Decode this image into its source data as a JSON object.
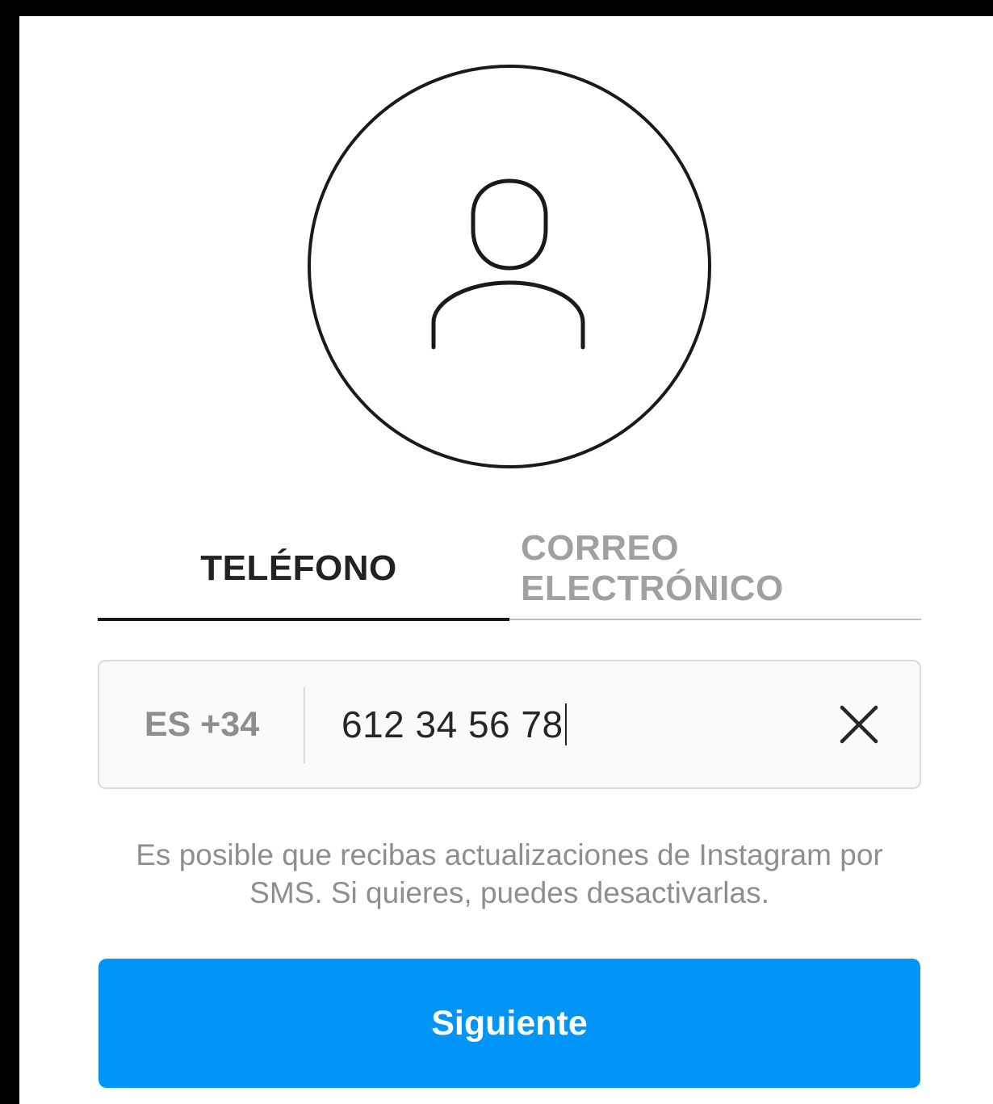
{
  "avatar": {
    "icon": "user-silhouette-icon"
  },
  "tabs": [
    {
      "label": "TELÉFONO",
      "active": true
    },
    {
      "label": "CORREO ELECTRÓNICO",
      "active": false
    }
  ],
  "phone": {
    "country_code": "ES +34",
    "value": "612 34 56 78",
    "clear_icon": "close-icon"
  },
  "notice": {
    "line1": "Es posible que recibas actualizaciones de Instagram por",
    "line2": "SMS. Si quieres, puedes desactivarlas."
  },
  "actions": {
    "next_label": "Siguiente"
  },
  "colors": {
    "primary_button": "#0095f6",
    "active_tab_text": "#222222",
    "inactive_tab_text": "#a0a0a0",
    "muted_text": "#8e8e8e",
    "input_background": "#fafafa",
    "border": "#dbdbdb"
  }
}
